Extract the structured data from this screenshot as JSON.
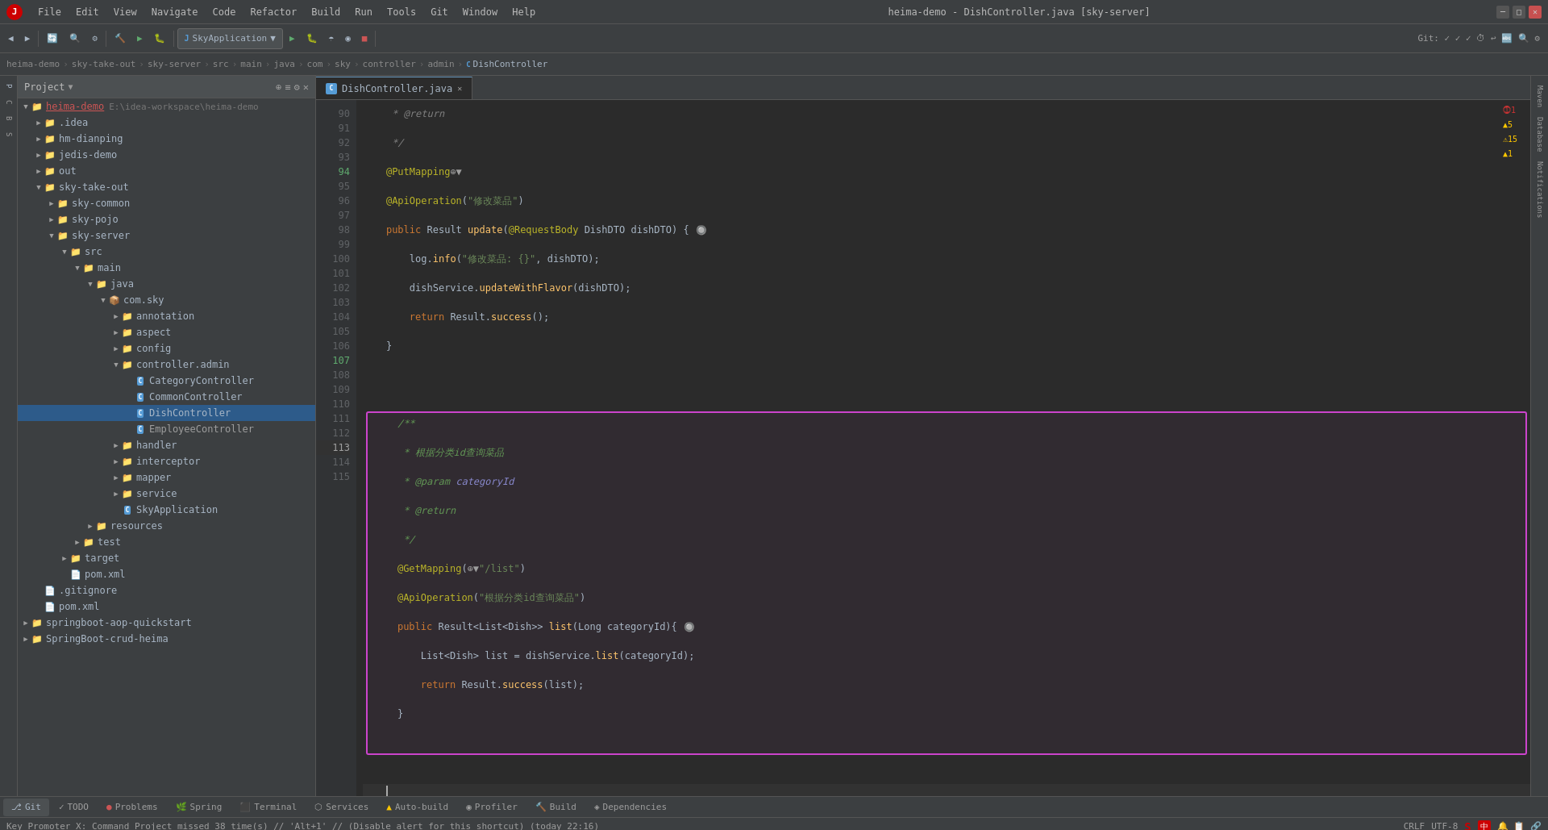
{
  "titlebar": {
    "title": "heima-demo - DishController.java [sky-server]",
    "menus": [
      "File",
      "Edit",
      "View",
      "Navigate",
      "Code",
      "Refactor",
      "Build",
      "Run",
      "Tools",
      "Git",
      "Window",
      "Help"
    ]
  },
  "breadcrumb": {
    "parts": [
      "heima-demo",
      "sky-take-out",
      "sky-server",
      "src",
      "main",
      "java",
      "com",
      "sky",
      "controller",
      "admin",
      "DishController"
    ]
  },
  "editor": {
    "tab_name": "DishController.java",
    "indicators": "⓵1 ▲5 ⚠15 ▲1"
  },
  "project_panel": {
    "title": "Project"
  },
  "toolbar": {
    "run_config": "SkyApplication"
  },
  "bottom_tabs": [
    {
      "label": "Git",
      "icon": "⎇"
    },
    {
      "label": "TODO",
      "icon": "✓"
    },
    {
      "label": "Problems",
      "icon": "●"
    },
    {
      "label": "Spring",
      "icon": "🌿"
    },
    {
      "label": "Terminal",
      "icon": ">_"
    },
    {
      "label": "Services",
      "icon": "⬡"
    },
    {
      "label": "Auto-build",
      "icon": "▲"
    },
    {
      "label": "Profiler",
      "icon": "◉"
    },
    {
      "label": "Build",
      "icon": "🔨"
    },
    {
      "label": "Dependencies",
      "icon": "◈"
    }
  ],
  "statusbar": {
    "message": "Key Promoter X: Command Project missed 38 time(s) // 'Alt+1' // (Disable alert for this shortcut) (today 22:16)",
    "encoding": "CRLF",
    "charset": "UTF-8"
  }
}
